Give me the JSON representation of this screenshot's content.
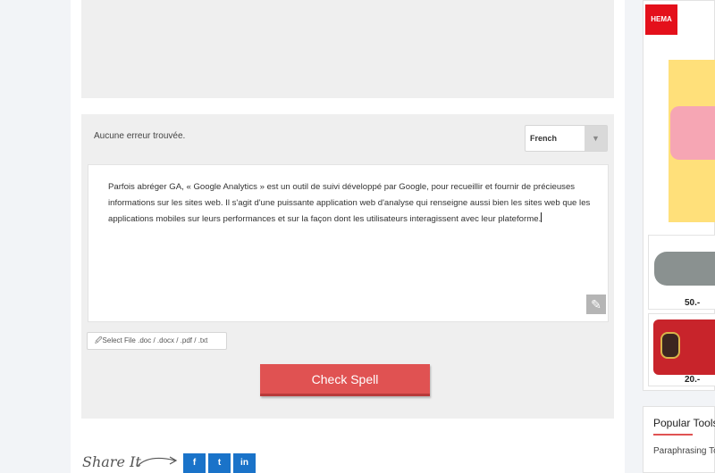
{
  "checker": {
    "status": "Aucune erreur trouvée.",
    "language": "French",
    "text": "Parfois abréger GA, « Google Analytics » est un outil de suivi développé par Google, pour recueillir et fournir de précieuses informations sur les sites web. Il s'agit d'une puissante application web d'analyse qui renseigne aussi bien les sites web que les applications mobiles sur leurs performances et sur la façon dont les utilisateurs interagissent avec leur plateforme.",
    "file_button": "Select File .doc / .docx / .pdf / .txt",
    "check_button": "Check Spell"
  },
  "share": {
    "label": "Share It",
    "facebook": "f",
    "twitter": "t",
    "linkedin": "in"
  },
  "ad": {
    "brand": "HEMA",
    "price1": "50.-",
    "price2": "20.-"
  },
  "sidebar": {
    "popular_title": "Popular Tools",
    "popular_item": "Paraphrasing Tool"
  }
}
